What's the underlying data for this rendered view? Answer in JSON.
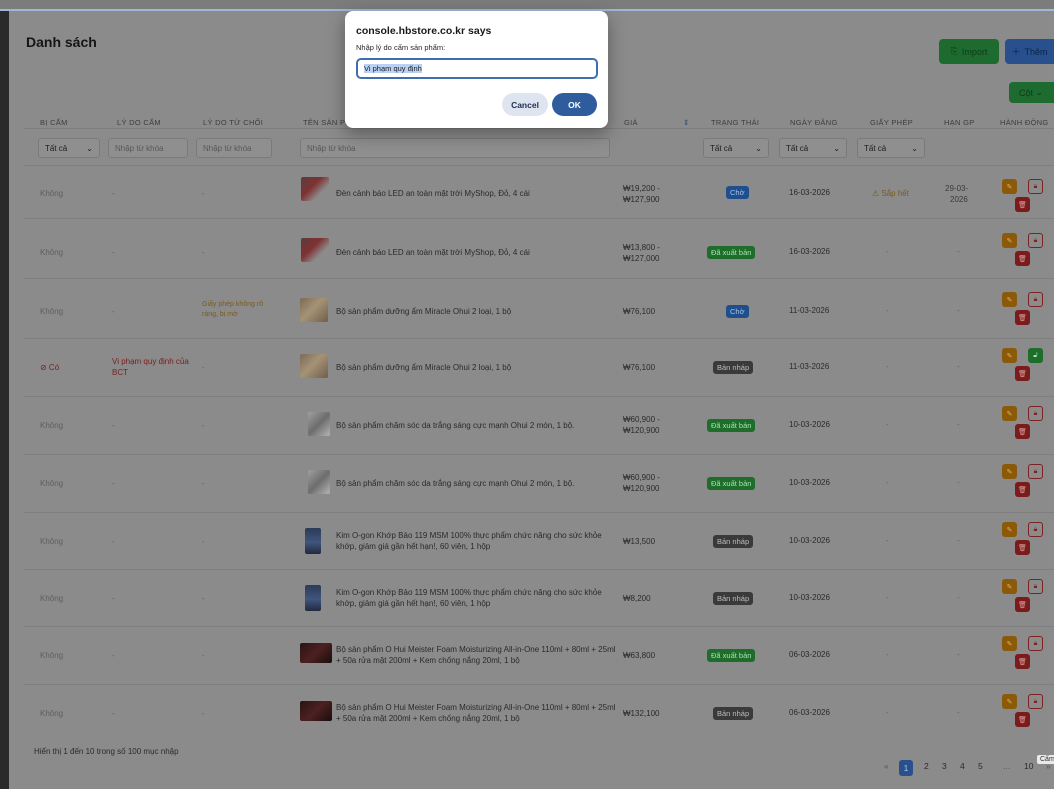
{
  "page": {
    "title": "Danh sách",
    "import_label": "Import",
    "add_label": "Thêm",
    "columns_label": "Cột"
  },
  "headers": [
    "BỊ CẤM",
    "LÝ DO CẤM",
    "LÝ DO TỪ CHỐI",
    "TÊN SẢN PHẨM",
    "GIÁ",
    "TRẠNG THÁI",
    "NGÀY ĐĂNG",
    "GIẤY PHÉP",
    "HẠN GP",
    "HÀNH ĐỘNG"
  ],
  "filters": {
    "banned": "Tất cả",
    "reason_ph": "Nhập từ khóa",
    "reject_ph": "Nhập từ khóa",
    "name_ph": "Nhập từ khóa",
    "status": "Tất cả",
    "date": "Tất cả",
    "license": "Tất cả"
  },
  "rows": [
    {
      "banned": "Không",
      "reason": "-",
      "reject": "-",
      "name": "Đèn cảnh báo LED an toàn mặt trời MyShop, Đỏ, 4 cái",
      "price": "₩19,200 -",
      "price2": "₩127,900",
      "status": "Chờ",
      "date": "16-03-2026",
      "license": "⚠ Sắp hết",
      "expiry": "29-03-",
      "expiry2": "2026"
    },
    {
      "banned": "Không",
      "reason": "-",
      "reject": "-",
      "name": "Đèn cảnh báo LED an toàn mặt trời MyShop, Đỏ, 4 cái",
      "price": "₩13,800 -",
      "price2": "₩127,000",
      "status": "Đã xuất bản",
      "date": "16-03-2026",
      "license": "-",
      "expiry": "-",
      "expiry2": ""
    },
    {
      "banned": "Không",
      "reason": "-",
      "reject": "Giấy phép không rõ ràng, bị mờ",
      "name": "Bộ sản phẩm dưỡng ẩm Miracle Ohui 2 loại, 1 bộ",
      "price": "₩76,100",
      "price2": "",
      "status": "Chờ",
      "date": "11-03-2026",
      "license": "-",
      "expiry": "-",
      "expiry2": ""
    },
    {
      "banned": "⊘ Có",
      "reason": "Vi phạm quy định của BCT",
      "reject": "-",
      "name": "Bộ sản phẩm dưỡng ẩm Miracle Ohui 2 loại, 1 bộ",
      "price": "₩76,100",
      "price2": "",
      "status": "Bản nháp",
      "date": "11-03-2026",
      "license": "-",
      "expiry": "-",
      "expiry2": ""
    },
    {
      "banned": "Không",
      "reason": "-",
      "reject": "-",
      "name": "Bộ sản phẩm chăm sóc da trắng sáng cực mạnh Ohui 2 món, 1 bộ.",
      "price": "₩60,900 -",
      "price2": "₩120,900",
      "status": "Đã xuất bản",
      "date": "10-03-2026",
      "license": "-",
      "expiry": "-",
      "expiry2": ""
    },
    {
      "banned": "Không",
      "reason": "-",
      "reject": "-",
      "name": "Bộ sản phẩm chăm sóc da trắng sáng cực mạnh Ohui 2 món, 1 bộ.",
      "price": "₩60,900 -",
      "price2": "₩120,900",
      "status": "Đã xuất bản",
      "date": "10-03-2026",
      "license": "-",
      "expiry": "-",
      "expiry2": ""
    },
    {
      "banned": "Không",
      "reason": "-",
      "reject": "-",
      "name": "Kim O-gon Khớp Bảo 119 MSM 100% thực phẩm chức năng cho sức khỏe khớp, giảm giá gần hết hạn!, 60 viên, 1 hộp",
      "price": "₩13,500",
      "price2": "",
      "status": "Bản nháp",
      "date": "10-03-2026",
      "license": "-",
      "expiry": "-",
      "expiry2": ""
    },
    {
      "banned": "Không",
      "reason": "-",
      "reject": "-",
      "name": "Kim O-gon Khớp Bảo 119 MSM 100% thực phẩm chức năng cho sức khỏe khớp, giảm giá gần hết hạn!, 60 viên, 1 hộp",
      "price": "₩8,200",
      "price2": "",
      "status": "Bản nháp",
      "date": "10-03-2026",
      "license": "-",
      "expiry": "-",
      "expiry2": ""
    },
    {
      "banned": "Không",
      "reason": "-",
      "reject": "-",
      "name": "Bộ sản phẩm O Hui Meister Foam Moisturizing All-in-One 110ml + 80ml + 25ml + 50a rửa mặt 200ml + Kem chống nắng 20ml, 1 bộ",
      "price": "₩63,800",
      "price2": "",
      "status": "Đã xuất bản",
      "date": "06-03-2026",
      "license": "-",
      "expiry": "-",
      "expiry2": ""
    },
    {
      "banned": "Không",
      "reason": "-",
      "reject": "-",
      "name": "Bộ sản phẩm O Hui Meister Foam Moisturizing All-in-One 110ml + 80ml + 25ml + 50a rửa mặt 200ml + Kem chống nắng 20ml, 1 bộ",
      "price": "₩132,100",
      "price2": "",
      "status": "Bản nháp",
      "date": "06-03-2026",
      "license": "-",
      "expiry": "-",
      "expiry2": ""
    }
  ],
  "footer": {
    "summary": "Hiển thị 1 đến 10 trong số 100 mục nhập",
    "pages": [
      "1",
      "2",
      "3",
      "4",
      "5",
      "...",
      "10"
    ],
    "tooltip": "Cấm"
  },
  "dialog": {
    "title": "console.hbstore.co.kr says",
    "message": "Nhập lý do cấm sản phẩm:",
    "value": "Vi phạm quy định",
    "cancel": "Cancel",
    "ok": "OK"
  },
  "colors": {
    "primary": "#2f5c9c",
    "success": "#1f6d2a",
    "danger": "#7b1b1b",
    "warning": "#8a5a0a"
  }
}
